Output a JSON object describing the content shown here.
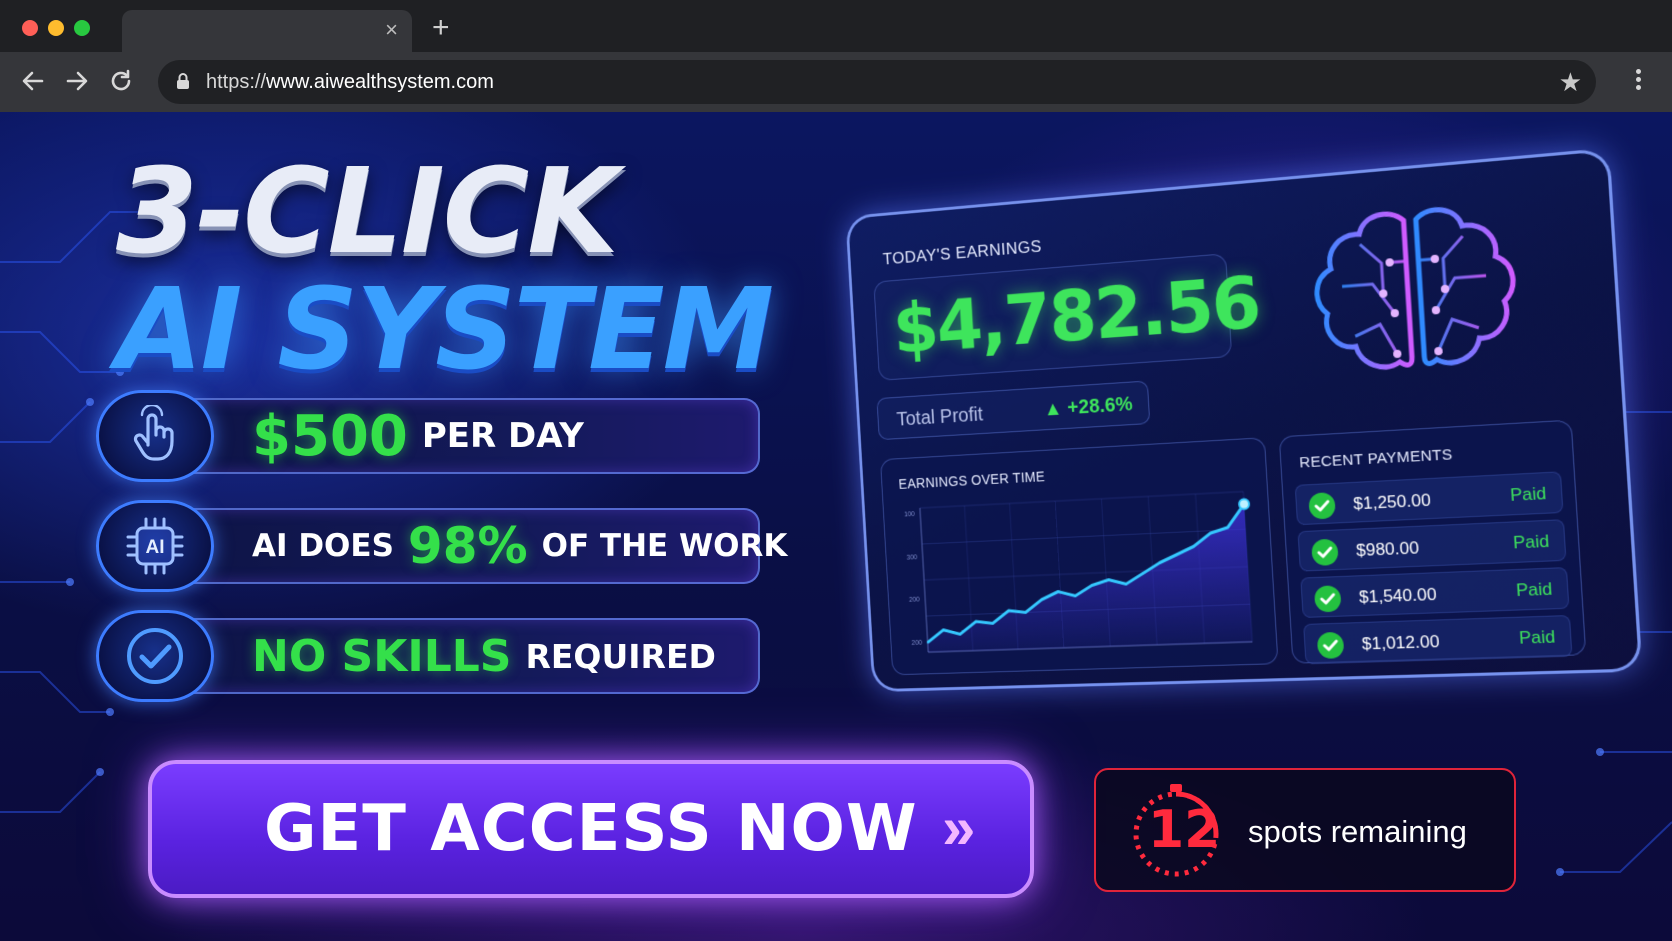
{
  "browser": {
    "tab_close": "×",
    "new_tab": "+",
    "url_scheme": "https://",
    "url_host": "www.aiwealthsystem.com",
    "icons": [
      "back-icon",
      "forward-icon",
      "reload-icon",
      "lock-icon",
      "star-icon",
      "menu-icon"
    ]
  },
  "hero": {
    "line1": "3-CLICK",
    "line2": "AI SYSTEM"
  },
  "features": [
    {
      "icon": "hand-pointer-icon",
      "highlight": "$500",
      "text": "PER DAY"
    },
    {
      "icon": "ai-chip-icon",
      "pre": "AI DOES",
      "highlight": "98%",
      "post": "OF THE WORK",
      "chip_label": "AI"
    },
    {
      "icon": "check-circle-icon",
      "highlight": "NO SKILLS",
      "text": "REQUIRED"
    }
  ],
  "cta": {
    "label": "GET ACCESS NOW",
    "chevron": "»"
  },
  "spots": {
    "number": "12",
    "text": "spots remaining"
  },
  "dashboard": {
    "earnings_label": "TODAY'S EARNINGS",
    "earnings_value": "$4,782.56",
    "profit_label": "Total Profit",
    "profit_change": "▲ +28.6%",
    "chart_title": "EARNINGS OVER TIME",
    "payments_title": "RECENT PAYMENTS",
    "payments": [
      {
        "amount": "$1,250.00",
        "status": "Paid"
      },
      {
        "amount": "$980.00",
        "status": "Paid"
      },
      {
        "amount": "$1,540.00",
        "status": "Paid"
      },
      {
        "amount": "$1,012.00",
        "status": "Paid"
      }
    ]
  },
  "chart_data": {
    "type": "line",
    "title": "EARNINGS OVER TIME",
    "xlabel": "",
    "ylabel": "",
    "y_ticks": [
      "100",
      "300",
      "200",
      "200"
    ],
    "x": [
      1,
      2,
      3,
      4,
      5,
      6,
      7,
      8,
      9,
      10,
      11,
      12,
      13,
      14,
      15,
      16,
      17,
      18,
      19,
      20
    ],
    "values": [
      8,
      18,
      14,
      24,
      22,
      32,
      30,
      40,
      46,
      42,
      50,
      54,
      50,
      58,
      66,
      72,
      78,
      88,
      92,
      110
    ],
    "ylim": [
      0,
      120
    ],
    "grid": true,
    "colors": {
      "line": "#35c8ff",
      "fill": "#3a2fd0"
    }
  },
  "colors": {
    "accent_green": "#34e04a",
    "accent_blue": "#3aa0ff",
    "cta_purple": "#6a2ef0",
    "alert_red": "#ff2a3d"
  }
}
